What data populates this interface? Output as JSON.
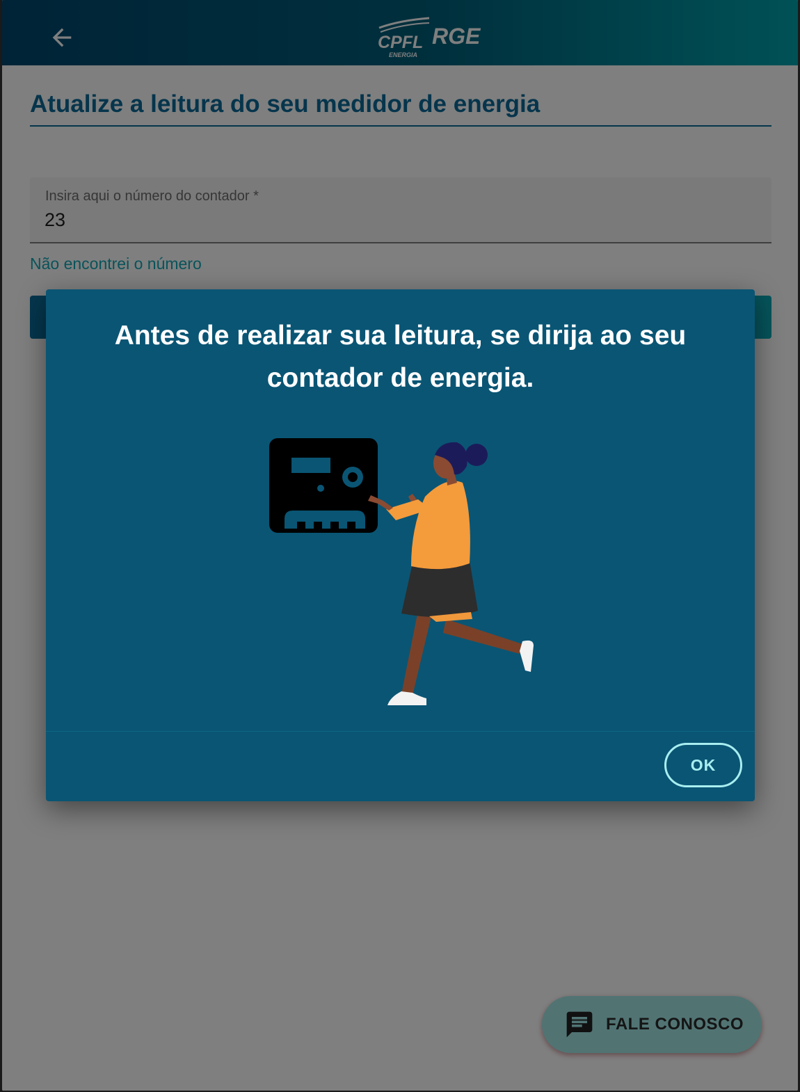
{
  "header": {
    "back_icon": "arrow-left-icon",
    "logo_cpfl": "CPFL",
    "logo_energia": "ENERGIA",
    "logo_rge": "RGE"
  },
  "main": {
    "title": "Atualize a leitura do seu medidor de energia",
    "counter_field": {
      "label": "Insira aqui o número do contador *",
      "value": "23"
    },
    "help_link": "Não encontrei o número"
  },
  "dialog": {
    "message": "Antes de realizar sua leitura, se dirija ao seu contador de energia.",
    "illustration": "person-walking-to-energy-meter",
    "ok_label": "OK"
  },
  "chat": {
    "icon": "chat-message-icon",
    "label": "FALE CONOSCO"
  },
  "colors": {
    "brand_primary": "#0c6b98",
    "brand_accent": "#12a7b5",
    "dialog_bg": "#0a5574",
    "ok_border": "#a8eef0",
    "chat_bg": "#a3e8e6"
  }
}
